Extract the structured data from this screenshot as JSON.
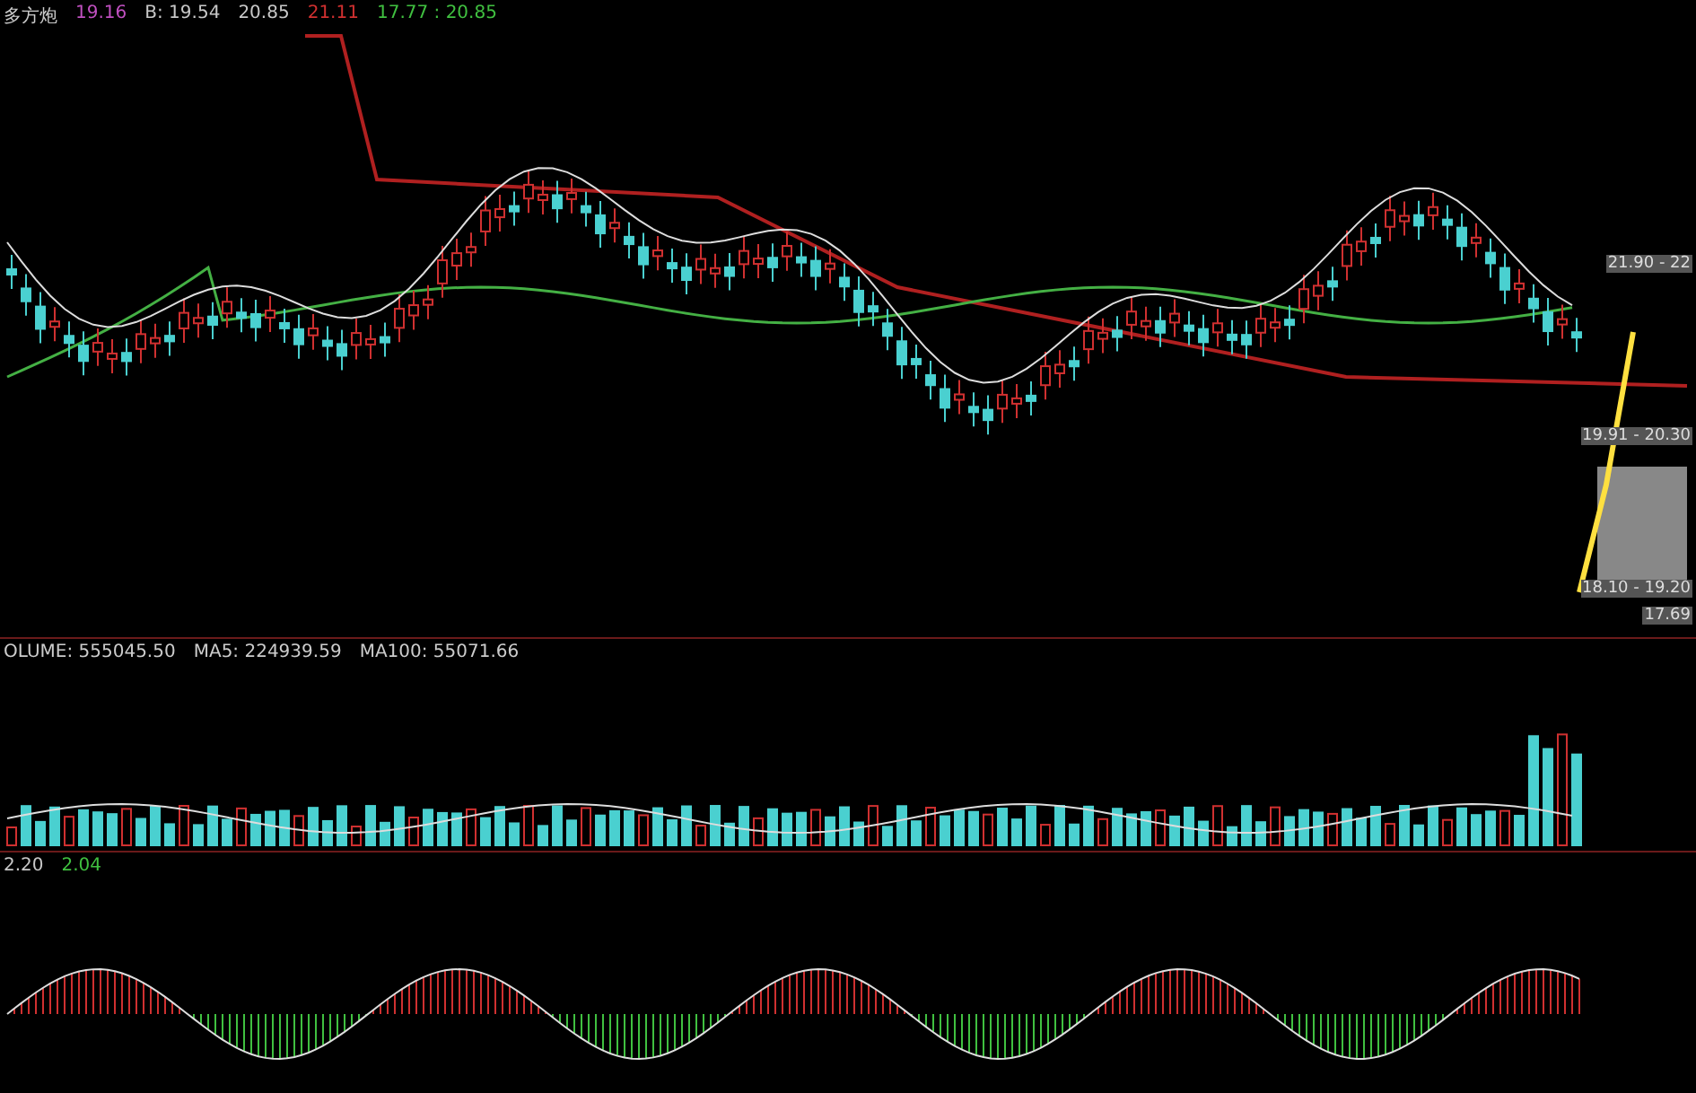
{
  "main_panel": {
    "title": "多方炮",
    "legend": [
      {
        "text": "19.16",
        "color": "#c050c0"
      },
      {
        "text": "B: 19.54",
        "color": "#c8c8c8"
      },
      {
        "text": "20.85",
        "color": "#c8c8c8"
      },
      {
        "text": "21.11",
        "color": "#d03030"
      },
      {
        "text": "17.77 : 20.85",
        "color": "#40c040"
      }
    ],
    "zones": [
      {
        "label": "21.90 - 22"
      },
      {
        "label": "19.91 - 20.30"
      },
      {
        "label": "18.10 - 19.20"
      },
      {
        "label": "17.69"
      }
    ]
  },
  "volume_panel": {
    "legend": [
      {
        "text": "OLUME: 555045.50"
      },
      {
        "text": "MA5: 224939.59"
      },
      {
        "text": "MA100: 55071.66"
      }
    ]
  },
  "oscillator_panel": {
    "legend": [
      {
        "text": "2.20",
        "color": "#c8c8c8"
      },
      {
        "text": "2.04",
        "color": "#40c040"
      }
    ]
  }
}
